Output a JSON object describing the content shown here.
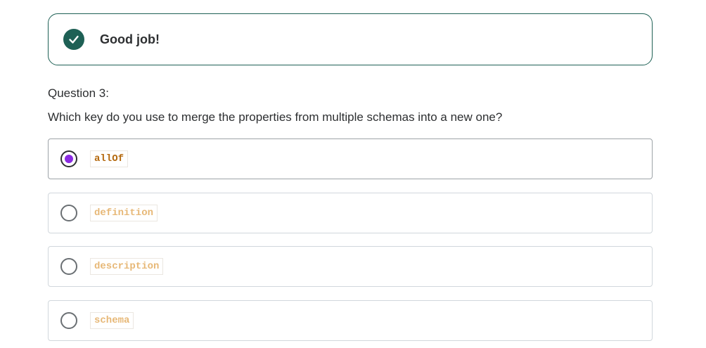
{
  "feedback": {
    "message": "Good job!",
    "icon": "check-circle-icon",
    "color": "#1e6055"
  },
  "question": {
    "number": "Question 3:",
    "prompt": "Which key do you use to merge the properties from multiple schemas into a new one?"
  },
  "answers": [
    {
      "label": "allOf",
      "selected": true
    },
    {
      "label": "definition",
      "selected": false
    },
    {
      "label": "description",
      "selected": false
    },
    {
      "label": "schema",
      "selected": false
    }
  ],
  "colors": {
    "radio_selected": "#8a2be2",
    "code_selected": "#b4690e",
    "code_unselected": "#e7b877"
  }
}
